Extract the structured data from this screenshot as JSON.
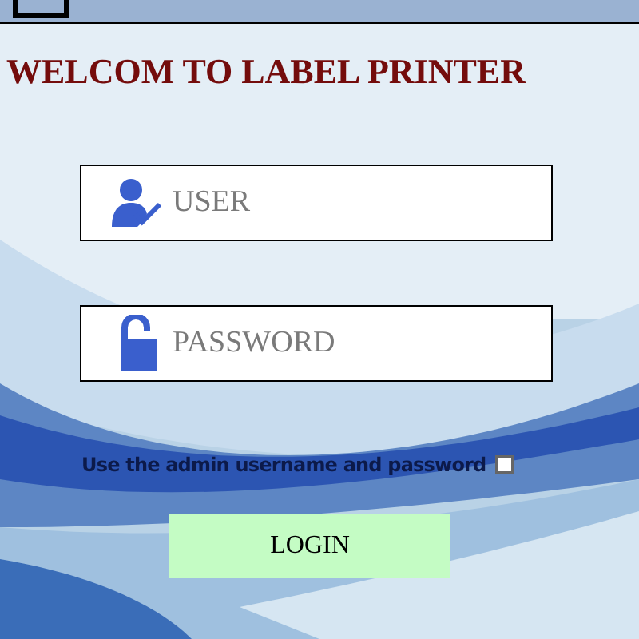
{
  "title": "WELCOM TO LABEL PRINTER",
  "fields": [
    {
      "kind": "user",
      "placeholder": "USER"
    },
    {
      "kind": "password",
      "placeholder": "PASSWORD"
    }
  ],
  "admin_option": {
    "label": "Use the admin username and password",
    "checked": false
  },
  "login_button": {
    "label": "LOGIN"
  }
}
